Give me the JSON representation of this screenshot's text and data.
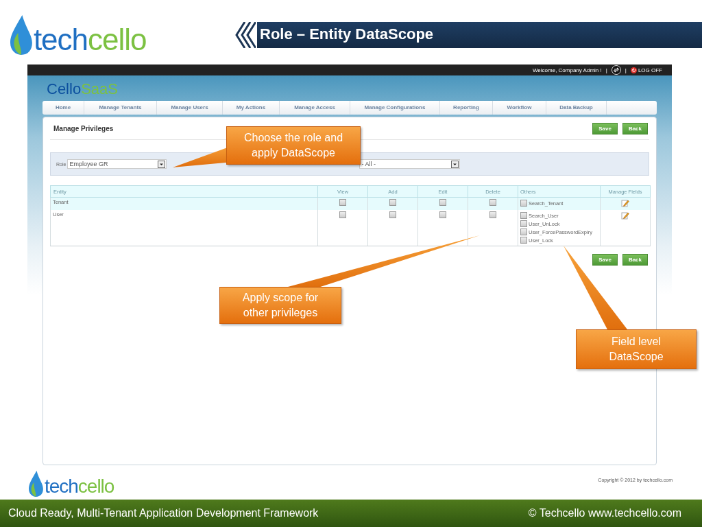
{
  "slide": {
    "brand": [
      "tech",
      "cello"
    ],
    "title": "Role – Entity DataScope"
  },
  "app": {
    "top_bar": {
      "welcome": "Welcome, Company Admin !",
      "separators": [
        "|",
        "|"
      ],
      "logoff": "LOG OFF"
    },
    "logo": [
      "Cello",
      "SaaS"
    ],
    "nav": [
      {
        "label": "Home"
      },
      {
        "label": "Manage Tenants"
      },
      {
        "label": "Manage Users"
      },
      {
        "label": "My Actions"
      },
      {
        "label": "Manage Access"
      },
      {
        "label": "Manage Configurations"
      },
      {
        "label": "Reporting"
      },
      {
        "label": "Workflow"
      },
      {
        "label": "Data Backup"
      }
    ],
    "page_title": "Manage Privileges",
    "buttons": [
      "Save",
      "Back"
    ],
    "filter": {
      "role_label": "Role",
      "role_value": "Employee GR",
      "scope_value": "- All -"
    },
    "table": {
      "columns": [
        "Entity",
        "View",
        "Add",
        "Edit",
        "Delete",
        "Others",
        "Manage Fields"
      ],
      "rows": [
        {
          "entity": "Tenant",
          "highlighted": true,
          "view": false,
          "add": false,
          "edit": false,
          "delete": false,
          "others": [
            {
              "label": "Search_Tenant",
              "checked": false
            }
          ]
        },
        {
          "entity": "User",
          "highlighted": false,
          "view": false,
          "add": false,
          "edit": false,
          "delete": false,
          "others": [
            {
              "label": "Search_User",
              "checked": false
            },
            {
              "label": "User_UnLock",
              "checked": false
            },
            {
              "label": "User_ForcePasswordExpiry",
              "checked": false
            },
            {
              "label": "User_Lock",
              "checked": false
            }
          ]
        }
      ]
    },
    "bottom_buttons": [
      "Save",
      "Back"
    ],
    "copyright": "Copyright © 2012 by techcello.com"
  },
  "callouts": [
    {
      "text": "Choose the role and apply DataScope"
    },
    {
      "text": "Apply scope for other privileges"
    },
    {
      "text": "Field level DataScope"
    }
  ],
  "footer": {
    "brand": [
      "tech",
      "cello"
    ],
    "tagline": "Cloud Ready, Multi-Tenant Application Development Framework",
    "credit": "© Techcello www.techcello.com"
  }
}
